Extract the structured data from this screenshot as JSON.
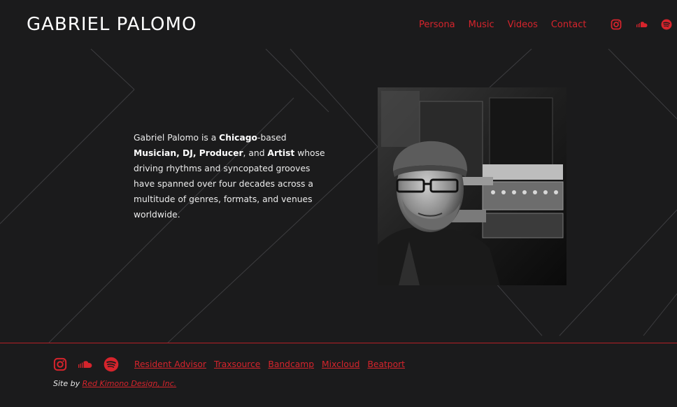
{
  "header": {
    "logo": "GABRIEL PALOMO",
    "nav": [
      {
        "label": "Persona"
      },
      {
        "label": "Music"
      },
      {
        "label": "Videos"
      },
      {
        "label": "Contact"
      }
    ],
    "social_icons": [
      "instagram-icon",
      "soundcloud-icon",
      "spotify-icon"
    ]
  },
  "bio": {
    "p1": "Gabriel Palomo is a ",
    "b1": "Chicago",
    "p2": "-based ",
    "b2": "Musician, DJ, Producer",
    "p3": ", and ",
    "b3": "Artist",
    "p4": " whose driving rhythms and syncopated grooves have spanned over four decades across a multitude of genres, formats, and venues worldwide."
  },
  "footer": {
    "social_icons": [
      "instagram-icon",
      "soundcloud-icon",
      "spotify-icon"
    ],
    "links": [
      {
        "label": "Resident Advisor"
      },
      {
        "label": "Traxsource"
      },
      {
        "label": "Bandcamp"
      },
      {
        "label": "Mixcloud"
      },
      {
        "label": "Beatport"
      }
    ],
    "credit_prefix": "Site by ",
    "credit_link": "Red Kimono Design, Inc."
  },
  "colors": {
    "background": "#1b1b1c",
    "accent": "#d6242c",
    "text": "#ececec"
  }
}
